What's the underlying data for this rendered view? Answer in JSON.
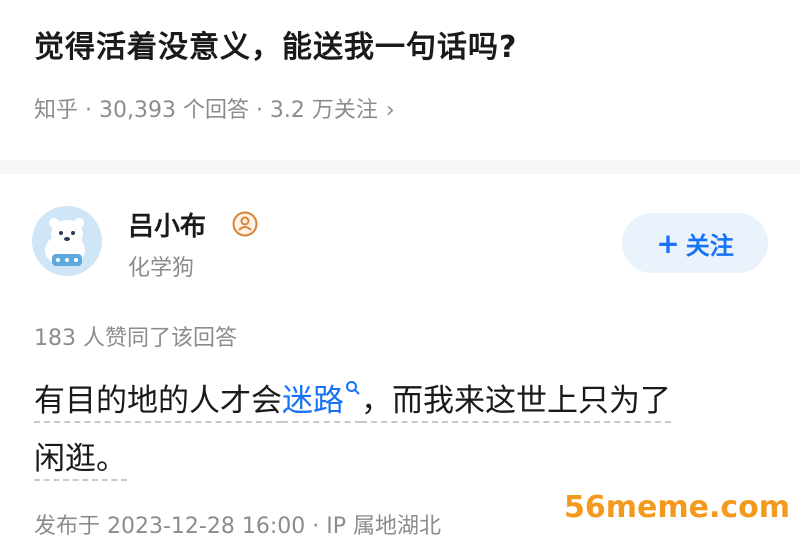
{
  "question": {
    "title": "觉得活着没意义，能送我一句话吗?",
    "meta": "知乎 · 30,393 个回答 · 3.2 万关注",
    "chevron": "›"
  },
  "author": {
    "name": "吕小布",
    "bio": "化学狗",
    "avatar_icon": "polar-bear-avatar-icon",
    "badge_icon": "user-badge-icon"
  },
  "follow_button": {
    "plus": "+",
    "label": "关注"
  },
  "answer": {
    "upvote_text": "183 人赞同了该回答",
    "line1_before": "有目的地的人才会",
    "line1_link": "迷路",
    "line1_after": "，而我来这世上只为了",
    "line2": "闲逛。"
  },
  "footer": {
    "meta": "发布于 2023-12-28 16:00 · IP 属地湖北"
  },
  "watermark": "56meme.com",
  "colors": {
    "accent": "#1772f6",
    "meta_gray": "#8c8c8c",
    "watermark": "#f39a1e"
  }
}
